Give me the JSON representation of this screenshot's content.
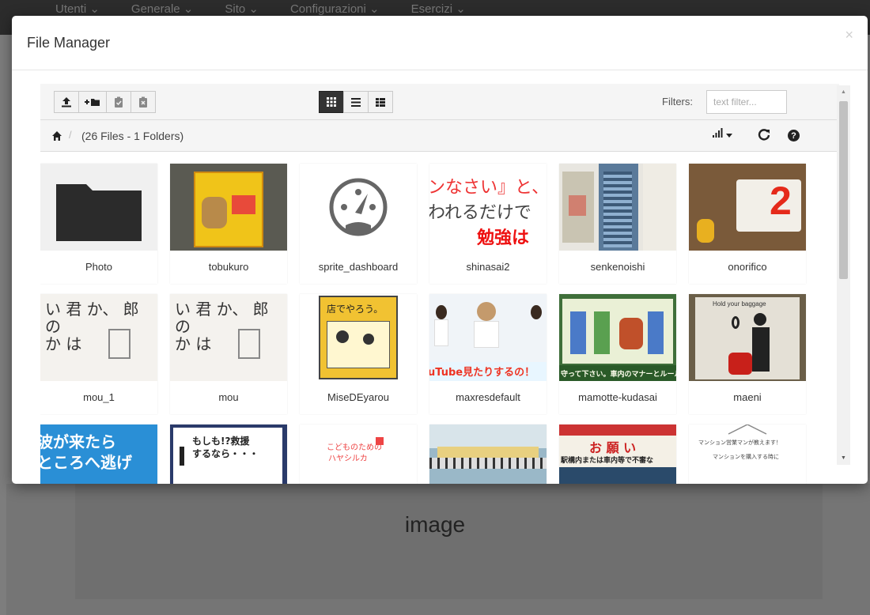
{
  "background_nav": {
    "items": [
      "Utenti ⌄",
      "Generale ⌄",
      "Sito ⌄",
      "Configurazioni ⌄",
      "Esercizi ⌄"
    ]
  },
  "background_text": "image",
  "modal": {
    "title": "File Manager",
    "close": "×"
  },
  "toolbar": {
    "filters_label": "Filters:",
    "filter_placeholder": "text filter..."
  },
  "breadcrumb": {
    "info": "(26 Files - 1 Folders)",
    "separator": "/"
  },
  "files": [
    {
      "name": "Photo",
      "type": "folder"
    },
    {
      "name": "tobukuro",
      "type": "image",
      "color": "#f0c419"
    },
    {
      "name": "sprite_dashboard",
      "type": "image"
    },
    {
      "name": "shinasai2",
      "type": "image"
    },
    {
      "name": "senkenoishi",
      "type": "image"
    },
    {
      "name": "onorifico",
      "type": "image"
    },
    {
      "name": "mou_1",
      "type": "image"
    },
    {
      "name": "mou",
      "type": "image"
    },
    {
      "name": "MiseDEyarou",
      "type": "image"
    },
    {
      "name": "maxresdefault",
      "type": "image"
    },
    {
      "name": "mamotte-kudasai",
      "type": "image"
    },
    {
      "name": "maeni",
      "type": "image"
    },
    {
      "name": "",
      "type": "image"
    },
    {
      "name": "",
      "type": "image"
    },
    {
      "name": "",
      "type": "image"
    },
    {
      "name": "",
      "type": "image"
    },
    {
      "name": "",
      "type": "image"
    },
    {
      "name": "",
      "type": "image"
    }
  ],
  "thumb_text": {
    "shinasai2": [
      "ンなさい』と、",
      "われるだけで",
      "勉強は"
    ],
    "mou": [
      "い 君 か、 郎",
      "の",
      "か は"
    ],
    "misede": "店でやろう。",
    "maxres": "uTube見たりするの！",
    "mamotte": "守って下さい。車内のマナーとルール",
    "maeni": "Hold your baggage",
    "row3_1": [
      "波が来たら",
      "ところへ逃げ"
    ],
    "row3_2": [
      "もしも!?救援",
      "するなら・・・"
    ],
    "row3_3": [
      "こどものための",
      "ハヤシルカ"
    ],
    "row3_5": [
      "お 願 い",
      "駅構内または車内等で不審な"
    ],
    "row3_6": [
      "マンション営業マンが教えます！",
      "マンションを購入する時に"
    ],
    "onorifico_num": "2"
  }
}
